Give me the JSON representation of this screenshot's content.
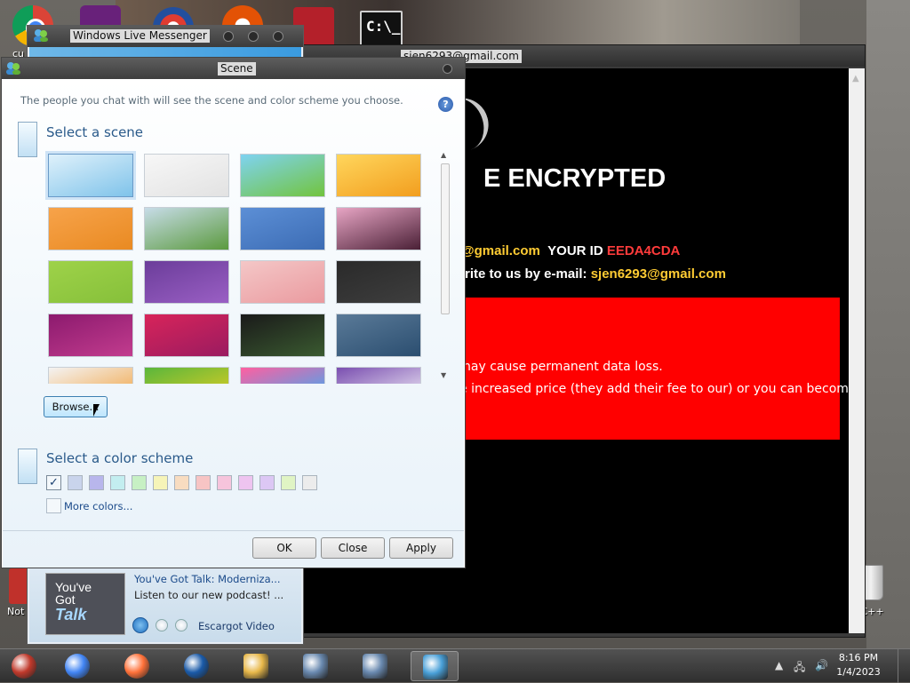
{
  "desktop": {
    "icons": [
      {
        "name": "chrome-desktop-icon"
      },
      {
        "name": "visual-studio-desktop-icon"
      },
      {
        "name": "security-app-desktop-icon"
      },
      {
        "name": "pidgin-desktop-icon"
      },
      {
        "name": "papers-please-desktop-icon"
      },
      {
        "name": "command-prompt-desktop-icon"
      }
    ],
    "cmd_icon_text": "C:\\_",
    "label_left_top": "cu",
    "label_left_bottom": "Not",
    "label_right_bottom": "n C++"
  },
  "ransom_window": {
    "title": "sjen6293@gmail.com",
    "heading": "E ENCRYPTED",
    "line1_email": "@gmail.com",
    "line1_label": "YOUR ID",
    "line1_id": "EEDA4CDA",
    "line2_text": "rite to us by e-mail:",
    "line2_email": "sjen6293@gmail.com",
    "red_line1": "nay cause permanent data loss.",
    "red_line2": "e increased price (they add their fee to our) or you can become"
  },
  "messenger": {
    "title": "Windows Live Messenger",
    "ad_thumb_line1": "You've",
    "ad_thumb_line2": "Got",
    "ad_thumb_line3": "Talk",
    "ad_title": "You've Got Talk: Moderniza...",
    "ad_subtitle": "Listen to our new podcast! ...",
    "media_label": "Escargot Video"
  },
  "scene_dialog": {
    "title": "Scene",
    "intro": "The people you chat with will see the scene and color scheme you choose.",
    "help_icon": "?",
    "scene_heading": "Select a scene",
    "color_heading": "Select a color scheme",
    "browse_label": "Browse...",
    "more_colors_label": "More colors...",
    "ok_label": "OK",
    "close_label": "Close",
    "apply_label": "Apply",
    "scenes": [
      {
        "name": "sky-blue",
        "colors": [
          "#dff1fb",
          "#7fc3ea"
        ],
        "selected": true
      },
      {
        "name": "white-clouds",
        "colors": [
          "#f7f7f7",
          "#e2e2e2"
        ]
      },
      {
        "name": "green-hills",
        "colors": [
          "#7fd3f1",
          "#72c43e"
        ]
      },
      {
        "name": "orange-tree",
        "colors": [
          "#ffd65c",
          "#f29e1f"
        ]
      },
      {
        "name": "orange-grass",
        "colors": [
          "#f7a34a",
          "#e98a22"
        ]
      },
      {
        "name": "field-windmill",
        "colors": [
          "#c7dce8",
          "#5b9a3e"
        ]
      },
      {
        "name": "blue-mountains",
        "colors": [
          "#5c8fd6",
          "#3c6cb4"
        ]
      },
      {
        "name": "pink-pattern",
        "colors": [
          "#e7a5c4",
          "#4a2036"
        ]
      },
      {
        "name": "green-dots",
        "colors": [
          "#9ed249",
          "#86c03a"
        ]
      },
      {
        "name": "purple-swirls",
        "colors": [
          "#6b3d9a",
          "#9a5fc4"
        ]
      },
      {
        "name": "pink-blossom",
        "colors": [
          "#f4c7c7",
          "#ea9a9f"
        ]
      },
      {
        "name": "dark-shapes",
        "colors": [
          "#2a2a2a",
          "#3e3e3e"
        ]
      },
      {
        "name": "magenta-flower",
        "colors": [
          "#8c1a6e",
          "#c23c8e"
        ]
      },
      {
        "name": "red-dots",
        "colors": [
          "#d8245a",
          "#9a1b60"
        ]
      },
      {
        "name": "dark-green-light",
        "colors": [
          "#1a1a1a",
          "#3a5a30"
        ]
      },
      {
        "name": "ocean-plane",
        "colors": [
          "#5a7a98",
          "#2b4e70"
        ]
      },
      {
        "name": "white-orange",
        "colors": [
          "#f3f3f3",
          "#f29a2e"
        ]
      },
      {
        "name": "palm-leaves",
        "colors": [
          "#5ab63c",
          "#f0d020"
        ]
      },
      {
        "name": "colorful-pattern",
        "colors": [
          "#ff5fa0",
          "#1fb6ff"
        ]
      },
      {
        "name": "purple-character",
        "colors": [
          "#7a4fb0",
          "#ffffff"
        ]
      }
    ],
    "color_swatches": [
      {
        "color": "#f4f8fb",
        "selected": true
      },
      {
        "color": "#c9d4ec"
      },
      {
        "color": "#b8b6ec"
      },
      {
        "color": "#c3eef0"
      },
      {
        "color": "#c7f0c4"
      },
      {
        "color": "#f6f4b8"
      },
      {
        "color": "#f8dcc0"
      },
      {
        "color": "#f7c4c4"
      },
      {
        "color": "#f6c4dc"
      },
      {
        "color": "#eec4f0"
      },
      {
        "color": "#dcc7f4"
      },
      {
        "color": "#e0f4c4"
      },
      {
        "color": "#ececec"
      }
    ]
  },
  "taskbar": {
    "items": [
      {
        "name": "chrome-alt-icon",
        "color": "#c0392b",
        "active": false
      },
      {
        "name": "chrome-icon",
        "color": "#4285f4",
        "active": false
      },
      {
        "name": "firefox-icon",
        "color": "#ff7139",
        "active": false
      },
      {
        "name": "obama-logo-icon",
        "color": "#1a5aa8",
        "active": false
      },
      {
        "name": "file-explorer-icon",
        "color": "#e8b84a",
        "active": false
      },
      {
        "name": "network-computer-icon",
        "color": "#6a8ab0",
        "active": false
      },
      {
        "name": "network-computer-icon-2",
        "color": "#6a8ab0",
        "active": false
      },
      {
        "name": "messenger-people-icon",
        "color": "#49a0d8",
        "active": true
      }
    ],
    "clock_time": "8:16 PM",
    "clock_date": "1/4/2023"
  }
}
